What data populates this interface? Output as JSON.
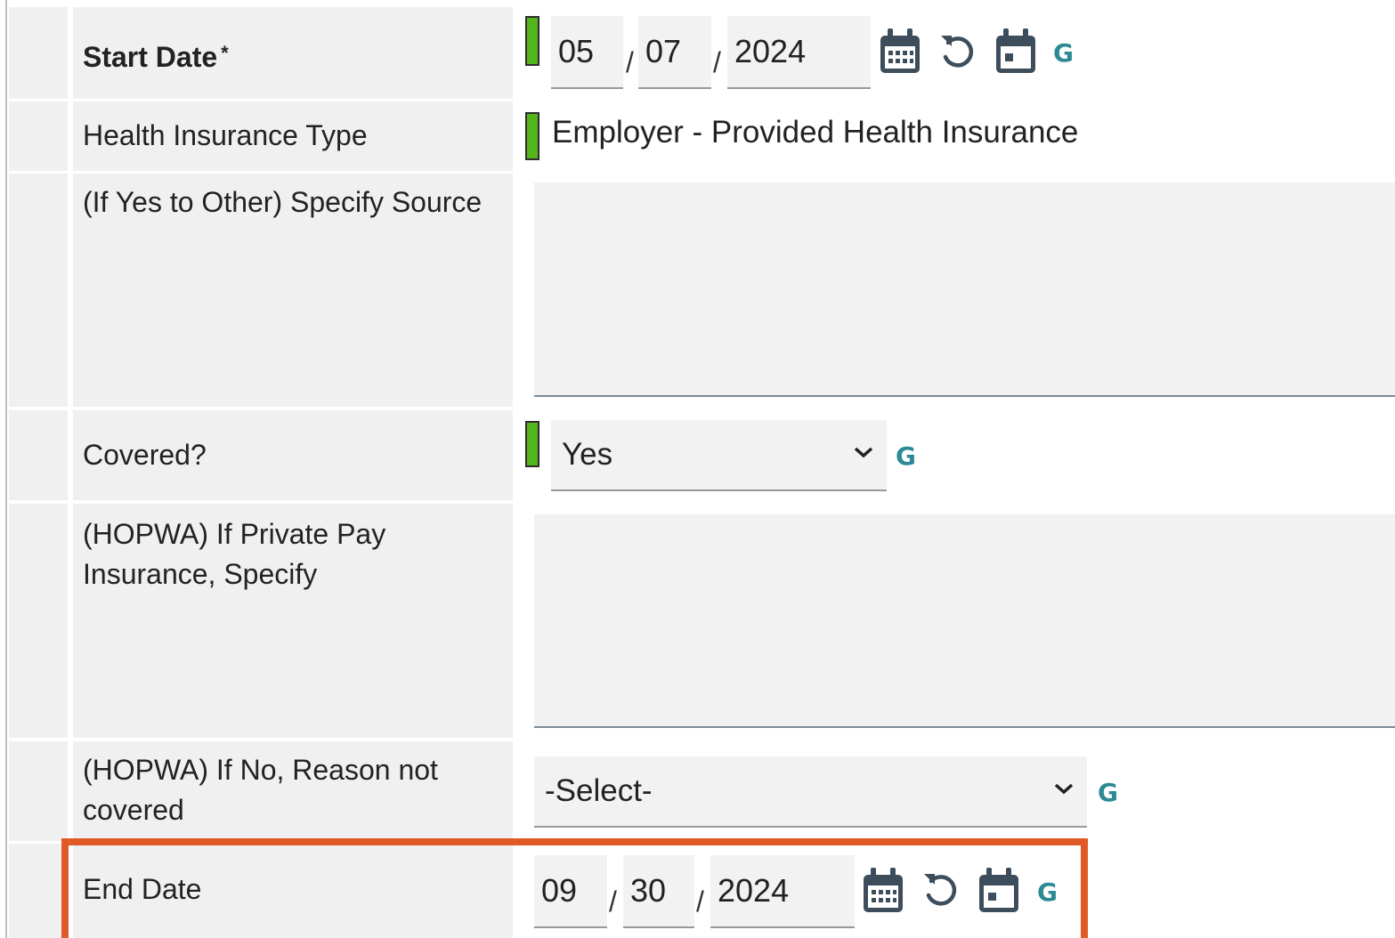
{
  "fields": {
    "start_date": {
      "label": "Start Date",
      "required_marker": "*",
      "month": "05",
      "day": "07",
      "year": "2024",
      "separator": "/",
      "g_label": "G"
    },
    "health_insurance_type": {
      "label": "Health Insurance Type",
      "value": "Employer - Provided Health Insurance"
    },
    "other_source": {
      "label": "(If Yes to Other) Specify Source",
      "value": ""
    },
    "covered": {
      "label": "Covered?",
      "selected": "Yes",
      "g_label": "G"
    },
    "hopwa_private_pay": {
      "label": "(HOPWA) If Private Pay Insurance, Specify",
      "value": ""
    },
    "hopwa_reason_not_covered": {
      "label": "(HOPWA) If No, Reason not covered",
      "selected": "-Select-",
      "g_label": "G"
    },
    "end_date": {
      "label": "End Date",
      "month": "09",
      "day": "30",
      "year": "2024",
      "separator": "/",
      "g_label": "G"
    }
  },
  "icons": [
    "calendar-icon",
    "reset-icon",
    "today-icon",
    "chevron-down-icon"
  ],
  "colors": {
    "required_indicator": "#55b51c",
    "link_g": "#2b8a94",
    "icon": "#3d4d5c",
    "highlight_border": "#e05a26",
    "label_bg": "#f0f0f0"
  }
}
